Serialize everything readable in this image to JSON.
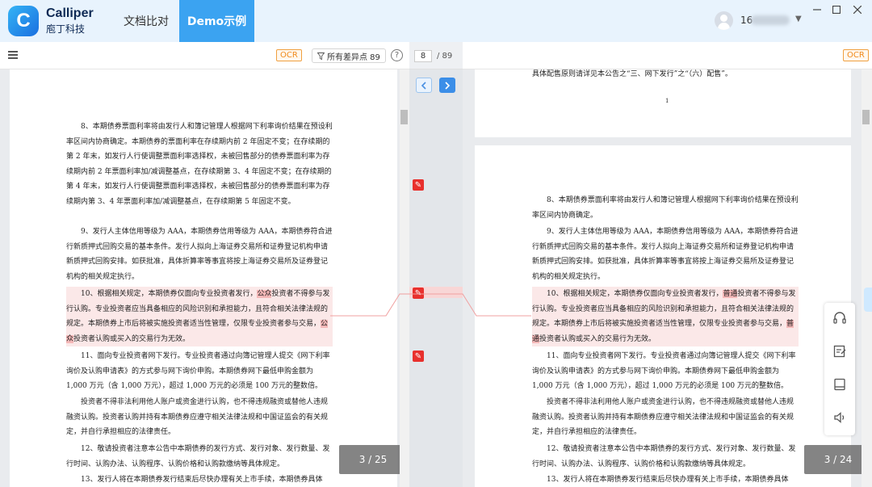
{
  "app": {
    "brand": "Calliper",
    "brand_sub": "庖丁科技",
    "tabs": [
      {
        "label": "文档比对",
        "active": false
      },
      {
        "label": "Demo示例",
        "active": true
      }
    ],
    "user_prefix": "16",
    "accent_color": "#3ba3f1"
  },
  "toolbar": {
    "ocr_label": "OCR",
    "filter_label": "所有差异点 89",
    "current_page": "8",
    "total_pages": "/  89"
  },
  "left_doc": {
    "paragraphs": [
      {
        "text": "8、本期债券票面利率将由发行人和簿记管理人根据网下利率询价结果在预设利率区间内协商确定。本期债券的票面利率在存续期内前 2 年固定不变；在存续期的第 2 年末，如发行人行使调整票面利率选择权，未被回售部分的债券票面利率为存续期内前 2 年票面利率加/减调整基点，在存续期第 3、4 年固定不变；在存续期的第 4 年末，如发行人行使调整票面利率选择权，未被回售部分的债券票面利率为存续期内第 3、4 年票面利率加/减调整基点，在存续期第 5 年固定不变。"
      },
      {
        "text": "9、发行人主体信用等级为 AAA，本期债券信用等级为 AAA，本期债券符合进行新质押式回购交易的基本条件。发行人拟向上海证券交易所和证券登记机构申请新质押式回购安排。如获批准，具体折算率等事宜将按上海证券交易所及证券登记机构的相关规定执行。"
      },
      {
        "a": "10、根据相关规定，本期债券仅面向专业投资者发行，",
        "diff1": "公众",
        "b": "投资者不得参与发行认购。专业投资者应当具备相应的风险识别和承担能力，且符合相关法律法规的规定。本期债券上市后将被实施投资者适当性管理，仅限专业投资者参与交易，",
        "diff2": "公众",
        "c": "投资者认购或买入的交易行为无效。"
      },
      {
        "text": "11、面向专业投资者网下发行。专业投资者通过向簿记管理人提交《网下利率询价及认购申请表》的方式参与网下询价申购。本期债券网下最低申购金额为 1,000 万元（含 1,000 万元），超过 1,000 万元的必须是 100 万元的整数倍。"
      },
      {
        "text": "投资者不得非法利用他人账户或资金进行认购，也不得违规融资或替他人违规融资认购。投资者认购并持有本期债券应遵守相关法律法规和中国证监会的有关规定，并自行承担相应的法律责任。"
      },
      {
        "text": "12、敬请投资者注意本公告中本期债券的发行方式、发行对象、发行数量、发行时间、认购办法、认购程序、认购价格和认购款缴纳等具体规定。"
      },
      {
        "text": "13、发行人将在本期债券发行结束后尽快办理有关上市手续，本期债券具体"
      }
    ],
    "page_counter": "3    /  25"
  },
  "right_doc": {
    "top_text": "具体配售原则请详见本公告之“三、网下发行”之“（六）配售”。",
    "page_num": "1",
    "paragraphs": [
      {
        "text": "8、本期债券票面利率将由发行人和簿记管理人根据网下利率询价结果在预设利率区间内协商确定。"
      },
      {
        "text": "9、发行人主体信用等级为 AAA，本期债券信用等级为 AAA，本期债券符合进行新质押式回购交易的基本条件。发行人拟向上海证券交易所和证券登记机构申请新质押式回购安排。如获批准，具体折算率等事宜将按上海证券交易所及证券登记机构的相关规定执行。"
      },
      {
        "a": "10、根据相关规定，本期债券仅面向专业投资者发行，",
        "diff1": "普通",
        "b": "投资者不得参与发行认购。专业投资者应当具备相应的风险识别和承担能力，且符合相关法律法规的规定。本期债券上市后将被实施投资者适当性管理，仅限专业投资者参与交易，",
        "diff2": "普通",
        "c": "投资者认购或买入的交易行为无效。"
      },
      {
        "text": "11、面向专业投资者网下发行。专业投资者通过向簿记管理人提交《网下利率询价及认购申请表》的方式参与网下询价申购。本期债券网下最低申购金额为 1,000 万元（含 1,000 万元），超过 1,000 万元的必须是 100 万元的整数倍。"
      },
      {
        "text": "投资者不得非法利用他人账户或资金进行认购，也不得违规融资或替他人违规融资认购。投资者认购并持有本期债券应遵守相关法律法规和中国证监会的有关规定，并自行承担相应的法律责任。"
      },
      {
        "text": "12、敬请投资者注意本公告中本期债券的发行方式、发行对象、发行数量、发行时间、认购办法、认购程序、认购价格和认购款缴纳等具体规定。"
      },
      {
        "text": "13、发行人将在本期债券发行结束后尽快办理有关上市手续，本期债券具体"
      }
    ],
    "page_counter": "3    /  24"
  },
  "colors": {
    "diff_highlight": "#f5b8b8",
    "diff_marker": "#e8302d",
    "ocr_badge": "#f08a1c"
  },
  "icons": {
    "float_toolbar": [
      "headset-icon",
      "edit-note-icon",
      "book-icon",
      "speaker-icon"
    ]
  }
}
